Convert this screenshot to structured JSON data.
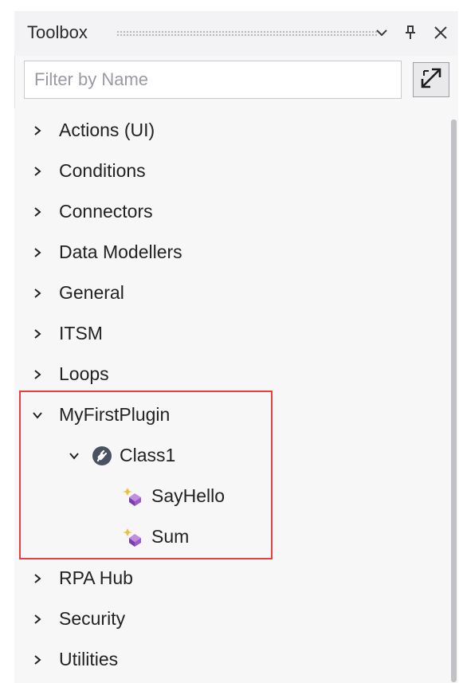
{
  "toolbox": {
    "title": "Toolbox",
    "filter_placeholder": "Filter by Name",
    "title_icons": [
      "chevron-down-icon",
      "pin-icon",
      "close-icon"
    ],
    "popout_icon": "expand-arrows-icon"
  },
  "tree": {
    "categories": [
      {
        "label": "Actions (UI)",
        "expanded": false
      },
      {
        "label": "Conditions",
        "expanded": false
      },
      {
        "label": "Connectors",
        "expanded": false
      },
      {
        "label": "Data Modellers",
        "expanded": false
      },
      {
        "label": "General",
        "expanded": false
      },
      {
        "label": "ITSM",
        "expanded": false
      },
      {
        "label": "Loops",
        "expanded": false
      },
      {
        "label": "MyFirstPlugin",
        "expanded": true
      },
      {
        "label": "RPA Hub",
        "expanded": false
      },
      {
        "label": "Security",
        "expanded": false
      },
      {
        "label": "Utilities",
        "expanded": false
      }
    ],
    "plugin": {
      "class_label": "Class1",
      "class_icon": "plugin-class-icon",
      "methods": [
        {
          "label": "SayHello",
          "icon": "method-icon"
        },
        {
          "label": "Sum",
          "icon": "method-icon"
        }
      ]
    }
  },
  "colors": {
    "highlight_border": "#e8403c",
    "panel_background": "#f7f7f8"
  }
}
